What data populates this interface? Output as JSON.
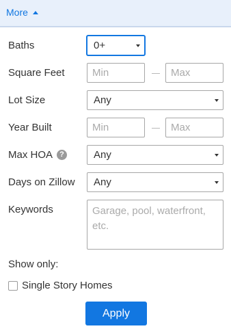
{
  "header": {
    "more_label": "More"
  },
  "filters": {
    "baths": {
      "label": "Baths",
      "value": "0+"
    },
    "square_feet": {
      "label": "Square Feet",
      "min_placeholder": "Min",
      "max_placeholder": "Max"
    },
    "lot_size": {
      "label": "Lot Size",
      "value": "Any"
    },
    "year_built": {
      "label": "Year Built",
      "min_placeholder": "Min",
      "max_placeholder": "Max"
    },
    "max_hoa": {
      "label": "Max HOA",
      "help_glyph": "?",
      "value": "Any"
    },
    "days_on_zillow": {
      "label": "Days on Zillow",
      "value": "Any"
    },
    "keywords": {
      "label": "Keywords",
      "placeholder": "Garage, pool, waterfront, etc."
    }
  },
  "show_only": {
    "label": "Show only:",
    "options": [
      {
        "label": "Single Story Homes",
        "checked": false
      }
    ]
  },
  "apply_label": "Apply",
  "colors": {
    "accent": "#1277e1",
    "header_bg": "#e8f0fb",
    "text": "#333333",
    "placeholder": "#aaaaaa"
  }
}
